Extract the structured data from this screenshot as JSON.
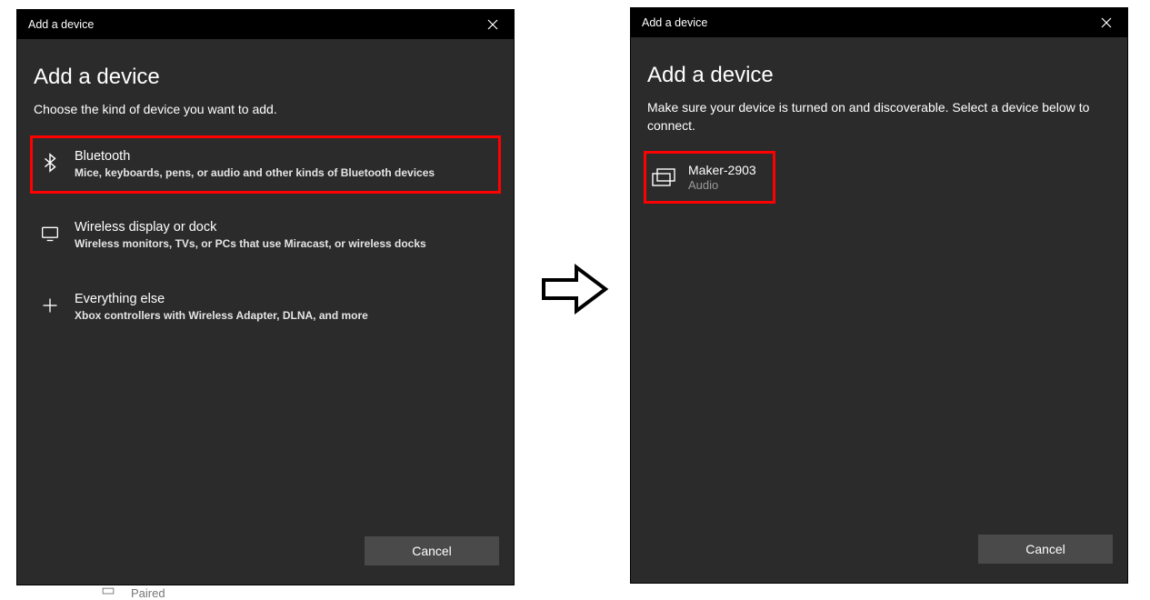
{
  "left": {
    "titlebar": "Add a device",
    "heading": "Add a device",
    "instruction": "Choose the kind of device you want to add.",
    "options": [
      {
        "title": "Bluetooth",
        "desc": "Mice, keyboards, pens, or audio and other kinds of Bluetooth devices"
      },
      {
        "title": "Wireless display or dock",
        "desc": "Wireless monitors, TVs, or PCs that use Miracast, or wireless docks"
      },
      {
        "title": "Everything else",
        "desc": "Xbox controllers with Wireless Adapter, DLNA, and more"
      }
    ],
    "cancel": "Cancel"
  },
  "right": {
    "titlebar": "Add a device",
    "heading": "Add a device",
    "instruction": "Make sure your device is turned on and discoverable. Select a device below to connect.",
    "device": {
      "name": "Maker-2903",
      "type": "Audio"
    },
    "cancel": "Cancel"
  },
  "remnant": "Paired"
}
